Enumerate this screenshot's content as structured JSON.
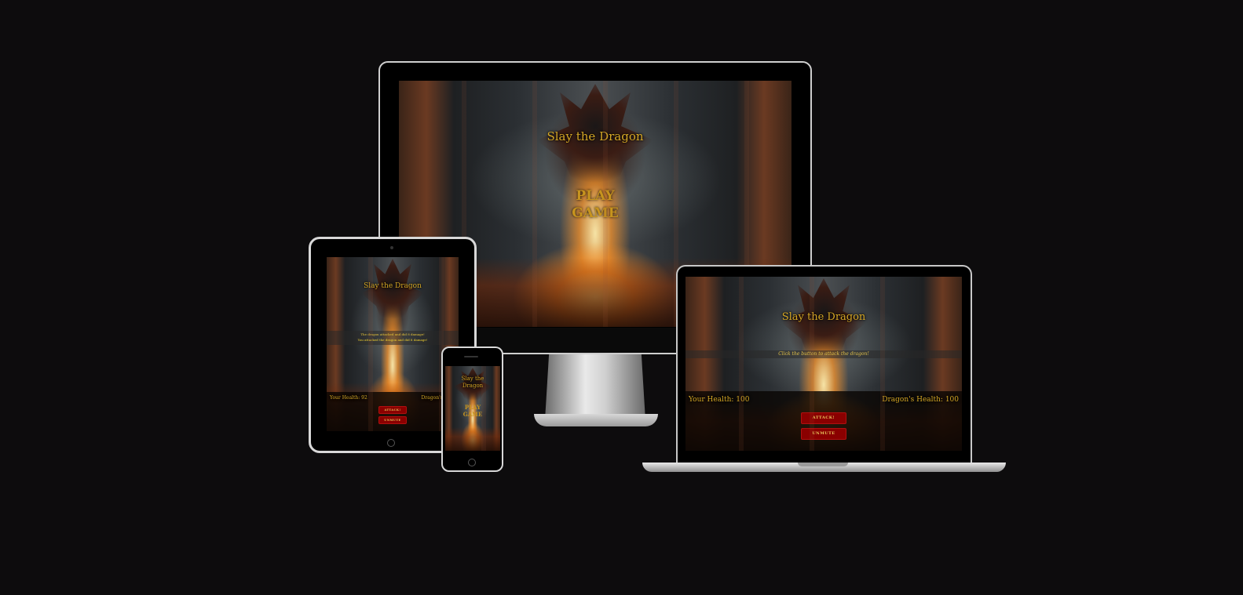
{
  "game": {
    "title": "Slay the Dragon",
    "play_line1": "PLAY",
    "play_line2": "GAME",
    "instruction": "Click the button to attack the dragon!",
    "your_health": "Your Health: 100",
    "dragon_health": "Dragon's Health: 100",
    "attack_label": "ATTACK!",
    "unmute_label": "UNMUTE"
  },
  "tablet": {
    "title": "Slay the Dragon",
    "message1": "The dragon attacked and did 8 damage!",
    "message2": "You attacked the dragon and did 8 damage!",
    "your_health": "Your Health: 92",
    "dragon_health": "Dragon's Heal",
    "attack_label": "ATTACK!",
    "unmute_label": "UNMUTE"
  },
  "phone": {
    "title_line1": "Slay the",
    "title_line2": "Dragon",
    "play_line1": "PLAY",
    "play_line2": "GAME"
  },
  "colors": {
    "background": "#0d0c0d",
    "gold_text": "#d6a826",
    "button_red": "#8a0000"
  }
}
